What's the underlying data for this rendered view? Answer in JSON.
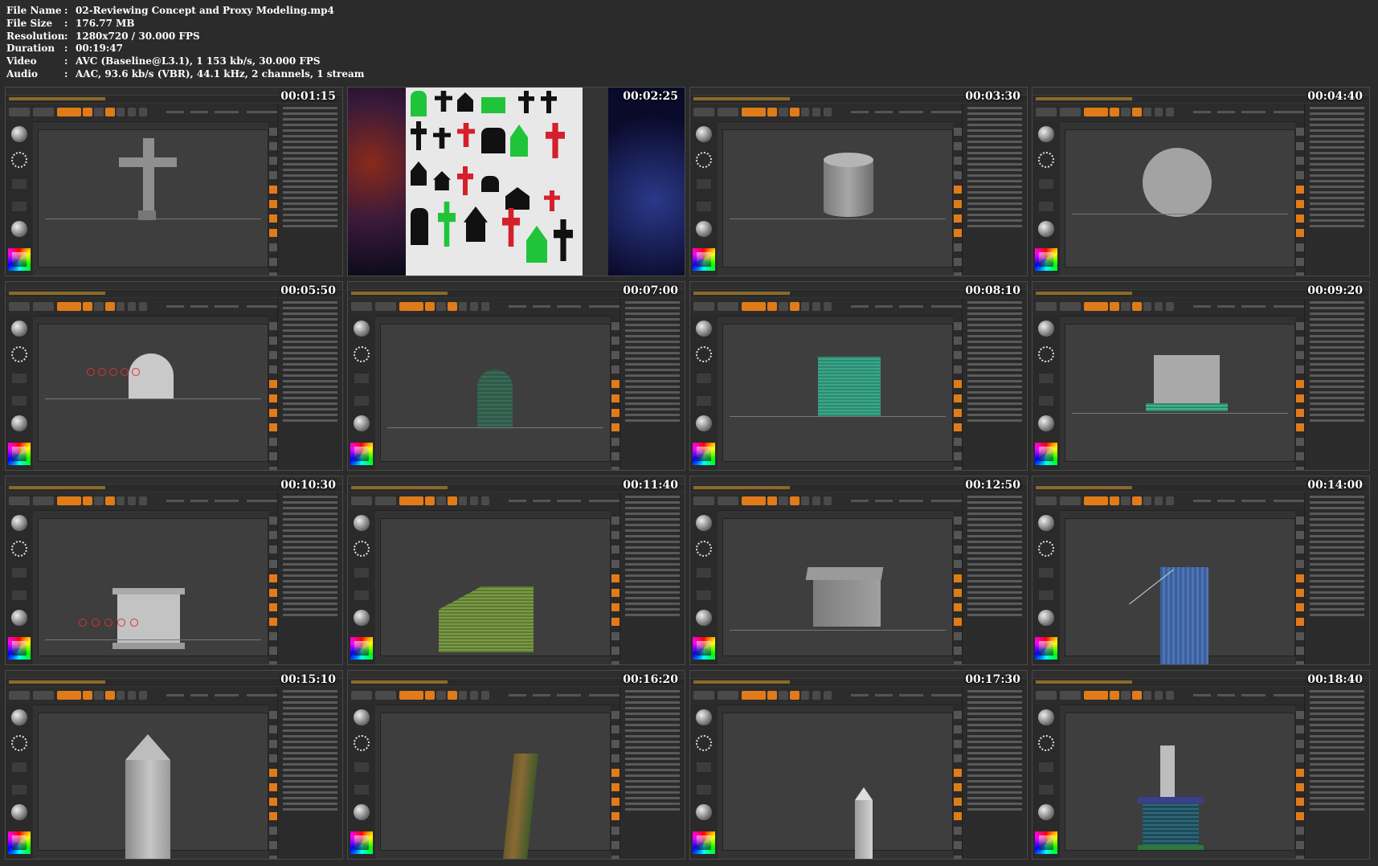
{
  "info": [
    {
      "key": "File Name",
      "value": "02-Reviewing Concept and Proxy Modeling.mp4"
    },
    {
      "key": "File Size",
      "value": "176.77 MB"
    },
    {
      "key": "Resolution",
      "value": "1280x720 / 30.000 FPS"
    },
    {
      "key": "Duration",
      "value": "00:19:47"
    },
    {
      "key": "Video",
      "value": "AVC (Baseline@L3.1), 1 153 kb/s, 30.000 FPS"
    },
    {
      "key": "Audio",
      "value": "AAC, 93.6 kb/s (VBR), 44.1 kHz, 2 channels, 1 stream"
    }
  ],
  "separator": ":",
  "thumbnails": [
    {
      "timestamp": "00:01:15",
      "content": "cross"
    },
    {
      "timestamp": "00:02:25",
      "content": "concept-sheet"
    },
    {
      "timestamp": "00:03:30",
      "content": "cylinder"
    },
    {
      "timestamp": "00:04:40",
      "content": "sphere"
    },
    {
      "timestamp": "00:05:50",
      "content": "arch-stone"
    },
    {
      "timestamp": "00:07:00",
      "content": "arch-stone-green"
    },
    {
      "timestamp": "00:08:10",
      "content": "block-teal"
    },
    {
      "timestamp": "00:09:20",
      "content": "block-base"
    },
    {
      "timestamp": "00:10:30",
      "content": "pedestal"
    },
    {
      "timestamp": "00:11:40",
      "content": "slab-green"
    },
    {
      "timestamp": "00:12:50",
      "content": "tomb"
    },
    {
      "timestamp": "00:14:00",
      "content": "pillar-blue"
    },
    {
      "timestamp": "00:15:10",
      "content": "obelisk"
    },
    {
      "timestamp": "00:16:20",
      "content": "obelisk-twist"
    },
    {
      "timestamp": "00:17:30",
      "content": "obelisk-small"
    },
    {
      "timestamp": "00:18:40",
      "content": "obelisk-base"
    }
  ],
  "colors": {
    "accent": "#e07b1a",
    "background": "#2b2b2b",
    "viewport": "#3e3e3e",
    "concept_green": "#1fc43a",
    "concept_red": "#d4202a"
  }
}
